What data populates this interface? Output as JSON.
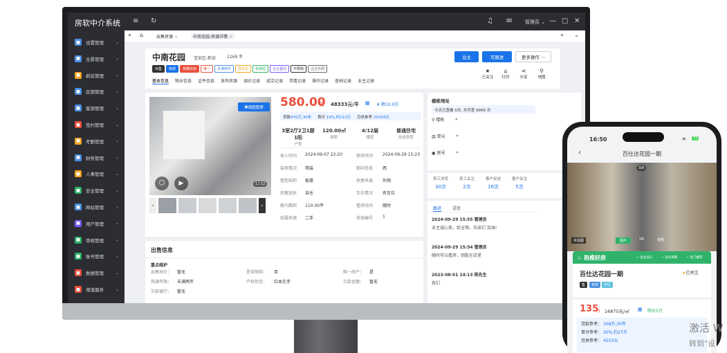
{
  "app": {
    "title": "房软中介系统",
    "user": "管理员"
  },
  "sidebar": {
    "items": [
      {
        "label": "设置管理",
        "color": "#4a90e2"
      },
      {
        "label": "全景管理",
        "color": "#4a90e2"
      },
      {
        "label": "新房管理",
        "color": "#f5a623"
      },
      {
        "label": "房源管理",
        "color": "#4a90e2"
      },
      {
        "label": "客源管理",
        "color": "#4a90e2"
      },
      {
        "label": "签约管理",
        "color": "#e94e3c"
      },
      {
        "label": "考勤管理",
        "color": "#f5a623"
      },
      {
        "label": "财务管理",
        "color": "#4a90e2"
      },
      {
        "label": "人事管理",
        "color": "#f5a623"
      },
      {
        "label": "安全管理",
        "color": "#2fb36b"
      },
      {
        "label": "网站管理",
        "color": "#4a90e2"
      },
      {
        "label": "用户管理",
        "color": "#7a5af5"
      },
      {
        "label": "审核管理",
        "color": "#2fb36b"
      },
      {
        "label": "账号管理",
        "color": "#2fb36b"
      },
      {
        "label": "数据管理",
        "color": "#e94e3c"
      },
      {
        "label": "增值服务",
        "color": "#e94e3c"
      }
    ]
  },
  "tabs": [
    {
      "label": "出售房源"
    },
    {
      "label": "中南花园-房源详情"
    }
  ],
  "property": {
    "name": "中南花园",
    "district": "宝安区-新安",
    "code": "2268",
    "tags": [
      "出售",
      "有效",
      "热推好房",
      "唯一",
      "未满两年",
      "限车位",
      "有钥匙",
      "业主委托",
      "不限购",
      "业主外网"
    ],
    "nav": [
      "基本信息",
      "物业信息",
      "证件信息",
      "发布房源",
      "调价记录",
      "成交记录",
      "带看记录",
      "操作记录",
      "查档记录",
      "业主记录"
    ],
    "buttons": {
      "owner": "业主",
      "write": "写跟进",
      "more": "更多操作 ···"
    },
    "actions": [
      "已关注",
      "打印",
      "分享",
      "地图"
    ],
    "price": "580.00",
    "price_unit": "万",
    "unit_price": "48333元/平",
    "drop": "降10.0万",
    "loan_line1": "贷款",
    "loan_amt": "470万,30年",
    "down_label": "首付",
    "down_val": "19%,约110万",
    "monthly_label": "月供参考",
    "monthly_val": "20334元",
    "layout": {
      "val": "3室2厅2卫1厨1阳",
      "lab": "户型"
    },
    "area": {
      "val": "120.00㎡",
      "lab": "面积"
    },
    "floor": {
      "val": "4/12层",
      "lab": "楼层"
    },
    "use": {
      "val": "普通住宅",
      "lab": "用途类型"
    },
    "details": [
      [
        "录入时间",
        "2024-09-07 22:20",
        "修改时间",
        "2024-09-29 15:23"
      ],
      [
        "装修情况",
        "简装",
        "朝向信息",
        "西"
      ],
      [
        "楼型结构",
        "板楼",
        "房屋来源",
        "外网"
      ],
      [
        "房屋现状",
        "自住",
        "车位情况",
        "有车位"
      ],
      [
        "套内面积",
        "110.00平",
        "看房时间",
        "随时"
      ],
      [
        "权属来源",
        "二手",
        "其他编号",
        "1"
      ]
    ],
    "photo_button": "视图管理",
    "photo_count": "1 / 12"
  },
  "building": {
    "title": "楼栋地址",
    "views": "今天已查看 0次, 共可查 9999 次",
    "rows": [
      "楼栋",
      "单元",
      "房号"
    ]
  },
  "stats": {
    "labels": [
      "员工浏览",
      "员工关注",
      "客户足迹",
      "客户关注"
    ],
    "values": [
      "30次",
      "2次",
      "16次",
      "5次"
    ]
  },
  "followup": {
    "tabs": [
      "跟进",
      "语音"
    ],
    "items": [
      {
        "head": "2024-09-29 15:55 管理员",
        "body": "业主诚心卖，给全佣，兄弟们 加油!"
      },
      {
        "head": "2024-09-29 15:54 管理员",
        "body": "随时可以看房，钥匙在店里"
      },
      {
        "head": "2023-08-01 14:13 杨先生",
        "body": "我们"
      }
    ]
  },
  "sale": {
    "title": "出售信息",
    "sub": "重点维护",
    "rows": [
      [
        "出售原价：",
        "暂无",
        "是否限购：",
        "否",
        "唯一房产：",
        "是"
      ],
      [
        "购满年限：",
        "未满两年",
        "产权状态：",
        "红本在手",
        "欠款金额：",
        "暂无"
      ],
      [
        "欠款银行：",
        "暂无"
      ]
    ]
  },
  "phone": {
    "time": "16:50",
    "battery": "73",
    "title": "百仕达花园一期",
    "img_count": "3/8",
    "img_tabs": [
      "实拍图",
      "图片",
      "VR",
      "视频"
    ],
    "banner": "热推好房",
    "banner_tags": [
      "业主诚心",
      "证长满两",
      "热门推荐"
    ],
    "name": "百仕达花园一期",
    "follow": "已关注",
    "tags": [
      "售",
      "有效",
      "学区"
    ],
    "price": "135",
    "price_unit": "万",
    "unit": "16875元/㎡",
    "drop": "降价5万",
    "loan_label": "贷款参考：",
    "loan_val": "108万,30年",
    "down_label": "首付参考：",
    "down_val": "20%,约27万",
    "monthly_label": "月供参考：",
    "monthly_val": "4553元"
  },
  "watermark": {
    "line1": "激活 W",
    "line2": "转到\"设"
  }
}
